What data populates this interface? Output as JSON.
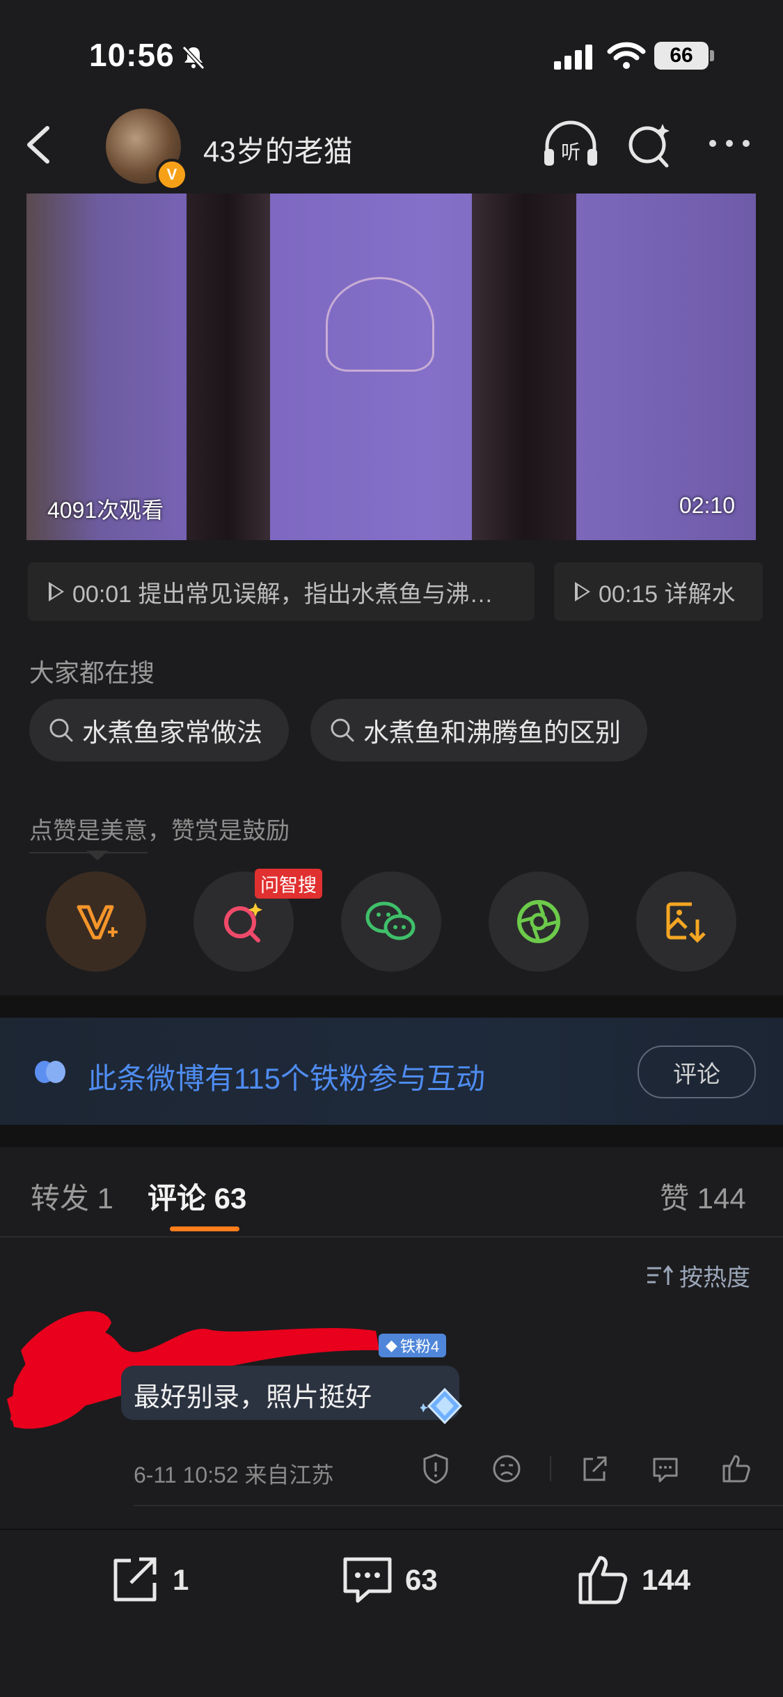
{
  "status_bar": {
    "time": "10:56",
    "battery": "66"
  },
  "header": {
    "user_name": "43岁的老猫",
    "listen_label": "听"
  },
  "video": {
    "views": "4091次观看",
    "duration": "02:10"
  },
  "chapters": [
    {
      "label": "00:01 提出常见误解，指出水煮鱼与沸…"
    },
    {
      "label": "00:15 详解水"
    }
  ],
  "hot_search": {
    "title": "大家都在搜",
    "items": [
      "水煮鱼家常做法",
      "水煮鱼和沸腾鱼的区别"
    ]
  },
  "reward": {
    "text": "点赞是美意，赞赏是鼓励",
    "badge": "问智搜"
  },
  "fan_banner": {
    "text": "此条微博有115个铁粉参与互动",
    "button": "评论"
  },
  "tabs": {
    "repost": "转发 1",
    "comments": "评论 63",
    "likes": "赞 144"
  },
  "sort": {
    "label": "按热度"
  },
  "comment": {
    "fan_tag": "铁粉4",
    "text": "最好别录，照片挺好",
    "meta": "6-11 10:52  来自江苏"
  },
  "bottom_bar": {
    "repost": "1",
    "comments": "63",
    "likes": "144"
  },
  "colors": {
    "accent_orange": "#ff7d1a",
    "fan_blue": "#4f8cf0",
    "background": "#1c1c1e"
  }
}
